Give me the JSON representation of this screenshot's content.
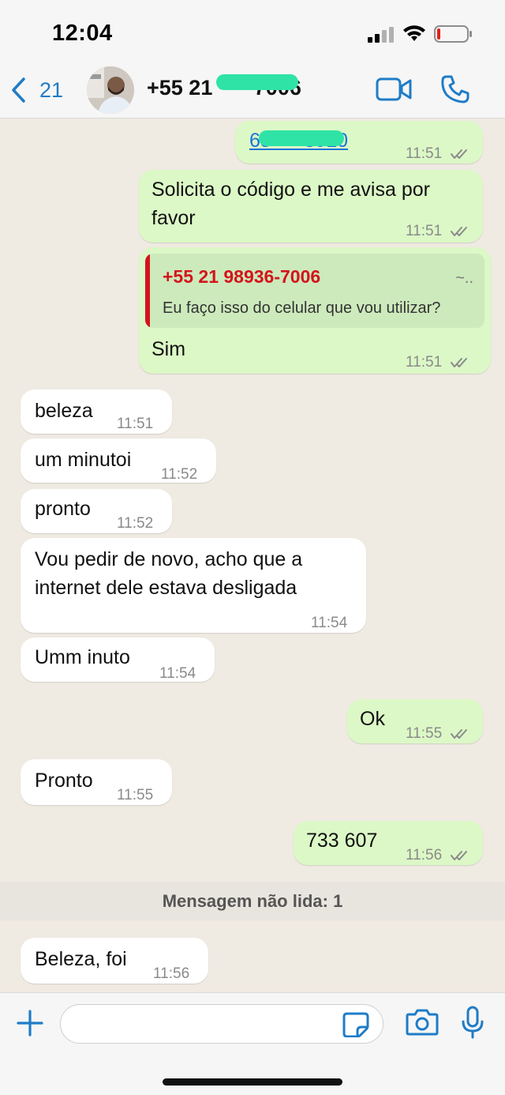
{
  "status_bar": {
    "time": "12:04"
  },
  "header": {
    "back_count": "21",
    "contact_name": "+55 21 ·····7006",
    "icons": [
      "chevron-left-icon",
      "video-call-icon",
      "phone-icon"
    ]
  },
  "messages": [
    {
      "direction": "out",
      "text": "65·····3910",
      "time": "11:51",
      "read": true,
      "is_link": true
    },
    {
      "direction": "out",
      "text_line1": "Solicita o código e me avisa por",
      "text_line2": "favor",
      "time": "11:51",
      "read": true
    },
    {
      "direction": "out",
      "quote_author": "+55 21 98936-7006",
      "quote_dots": "~..",
      "quote_text": "Eu faço isso do celular que vou utilizar?",
      "text": "Sim",
      "time": "11:51",
      "read": true
    },
    {
      "direction": "in",
      "text": "beleza",
      "time": "11:51"
    },
    {
      "direction": "in",
      "text": "um minutoi",
      "time": "11:52"
    },
    {
      "direction": "in",
      "text": "pronto",
      "time": "11:52"
    },
    {
      "direction": "in",
      "text_line1": "Vou pedir de novo, acho que a",
      "text_line2": "internet dele estava desligada",
      "time": "11:54"
    },
    {
      "direction": "in",
      "text": "Umm inuto",
      "time": "11:54"
    },
    {
      "direction": "out",
      "text": "Ok",
      "time": "11:55",
      "read": true
    },
    {
      "direction": "in",
      "text": "Pronto",
      "time": "11:55"
    },
    {
      "direction": "out",
      "text": "733 607",
      "time": "11:56",
      "read": true
    },
    {
      "direction": "in",
      "text": "Beleza, foi",
      "time": "11:56"
    }
  ],
  "unread_divider": "Mensagem não lida: 1",
  "composer": {
    "placeholder": "",
    "icons": [
      "plus-icon",
      "sticker-icon",
      "camera-icon",
      "microphone-icon"
    ]
  },
  "colors": {
    "accent": "#1f7cc7",
    "outgoing_bubble": "#dcf8c6",
    "incoming_bubble": "#ffffff",
    "chat_background": "#efeae2",
    "quote_author": "#d4141c",
    "read_ticks": "#8a8a8a"
  }
}
